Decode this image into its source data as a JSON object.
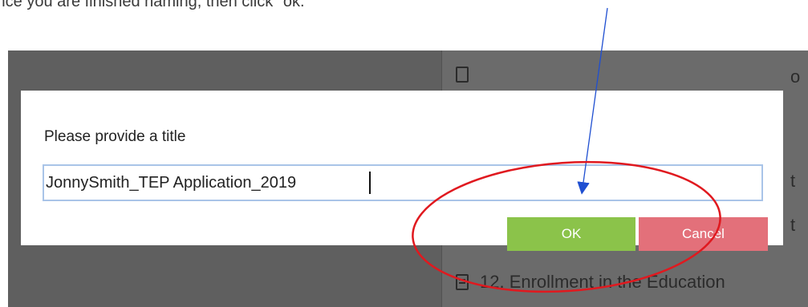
{
  "instruction": "Once you are finished naming, then click \"ok.\"",
  "background": {
    "list_item_12": "12. Enrollment in the Education"
  },
  "dialog": {
    "title": "Please provide a title",
    "input_value": "JonnySmith_TEP Application_2019",
    "ok_label": "OK",
    "cancel_label": "Cancel"
  },
  "colors": {
    "ok_button": "#8bc34a",
    "cancel_button": "#e3707a",
    "input_border": "#a9c4e8",
    "annotation_arrow": "#1f4fd1",
    "annotation_ellipse": "#e0191f"
  }
}
